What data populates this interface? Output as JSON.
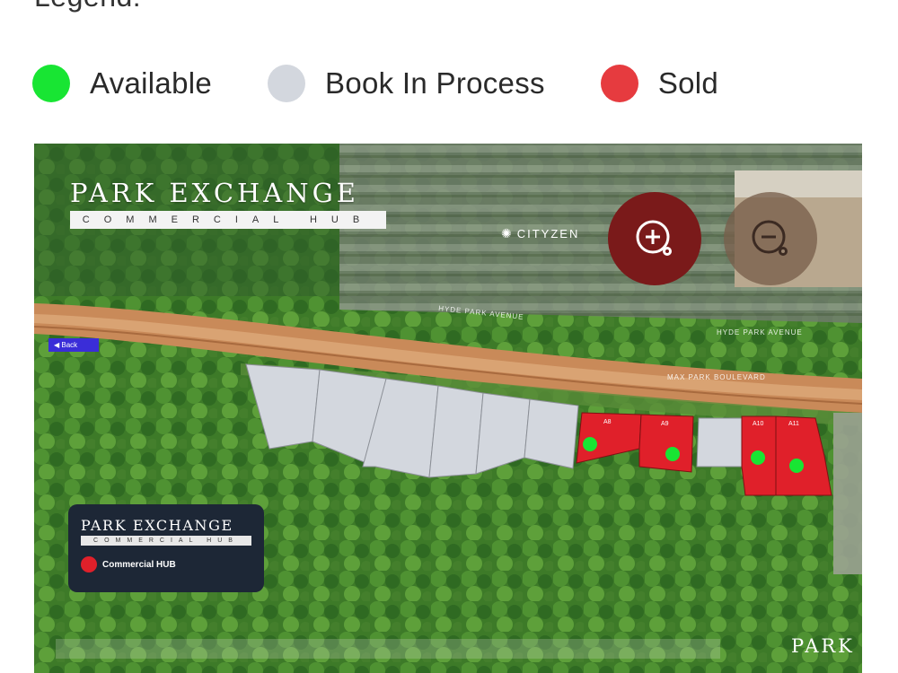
{
  "legend": {
    "title": "Legend:",
    "items": [
      {
        "label": "Available",
        "color": "#18e533"
      },
      {
        "label": "Book In Process",
        "color": "#d3d7de"
      },
      {
        "label": "Sold",
        "color": "#e63b3f"
      }
    ]
  },
  "map": {
    "brand_top": {
      "name": "PARK EXCHANGE",
      "sub": "COMMERCIAL HUB"
    },
    "developer_logo": "CITYZEN",
    "road_labels": [
      "HYDE PARK AVENUE",
      "HYDE PARK AVENUE",
      "MAX PARK BOULEVARD"
    ],
    "zoom_in_icon": "zoom-in-icon",
    "zoom_out_icon": "zoom-out-icon",
    "back_chip_label": "◀ Back",
    "brand_bottom": {
      "name": "PARK EXCHANGE",
      "sub": "COMMERCIAL HUB",
      "key_label": "Commercial HUB",
      "key_color": "#e0202a"
    },
    "corner_text": "PARK",
    "plot_labels": [
      "A8",
      "A9",
      "A10",
      "A11"
    ]
  }
}
